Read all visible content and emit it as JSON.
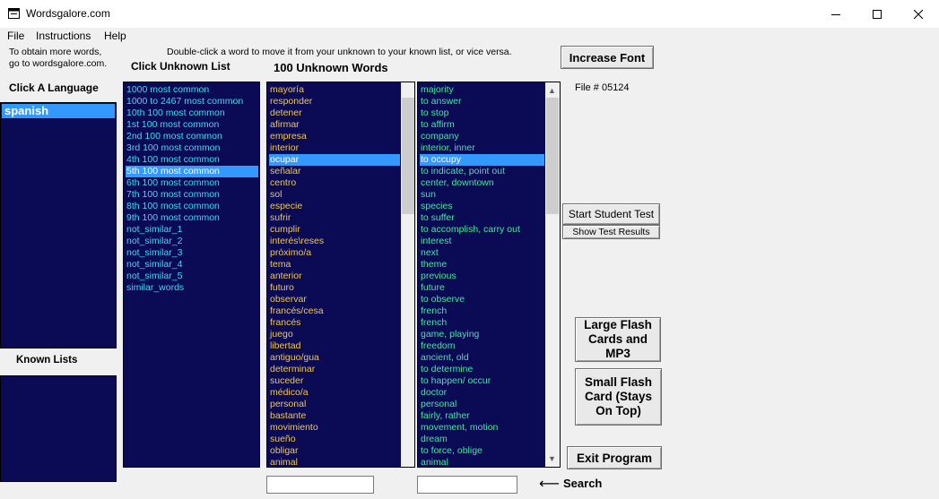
{
  "window": {
    "title": "Wordsgalore.com",
    "minimize_glyph": "—",
    "maximize_glyph": "☐",
    "close_glyph": "✕"
  },
  "menu": [
    "File",
    "Instructions",
    "Help"
  ],
  "info": {
    "line1": "To obtain more words,",
    "line2": "go to wordsgalore.com.",
    "hint": "Double-click a word to move it from your unknown to your known list, or vice versa."
  },
  "labels": {
    "click_unknown_list": "Click Unknown List",
    "unknown_words": "100 Unknown Words",
    "click_a_language": "Click A Language",
    "known_lists": "Known Lists",
    "file_number": "File # 05124",
    "search": "Search",
    "search_arrow": "⟵"
  },
  "languages": {
    "selected": "spanish"
  },
  "unknown_lists": {
    "selected_index": 7,
    "items": [
      "1000 most common",
      "1000 to 2467 most common",
      "10th 100 most common",
      "1st 100 most common",
      "2nd 100 most common",
      "3rd 100 most common",
      "4th 100 most common",
      "5th 100 most common",
      "6th 100 most common",
      "7th 100 most common",
      "8th 100 most common",
      "9th 100 most common",
      "not_similar_1",
      "not_similar_2",
      "not_similar_3",
      "not_similar_4",
      "not_similar_5",
      "similar_words"
    ]
  },
  "spanish_words": {
    "selected_index": 6,
    "items": [
      "mayoría",
      "responder",
      "detener",
      "afirmar",
      "empresa",
      "interior",
      "ocupar",
      "señalar",
      "centro",
      "sol",
      "especie",
      "sufrir",
      "cumplir",
      "interés\\reses",
      "próximo/a",
      "tema",
      "anterior",
      "futuro",
      "observar",
      "francés/cesa",
      "francés",
      "juego",
      "libertad",
      "antiguo/gua",
      "determinar",
      "suceder",
      "médico/a",
      "personal",
      "bastante",
      "movimiento",
      "sueño",
      "obligar",
      "animal"
    ]
  },
  "english_words": {
    "selected_index": 6,
    "items": [
      "majority",
      "to answer",
      "to stop",
      "to affirm",
      "company",
      "interior, inner",
      "to occupy",
      "to indicate, point out",
      "center, downtown",
      "sun",
      "species",
      "to suffer",
      "to accomplish, carry out",
      "interest",
      "next",
      "theme",
      "previous",
      "future",
      "to observe",
      "french",
      "french",
      "game, playing",
      "freedom",
      "ancient, old",
      "to determine",
      "to happen/ occur",
      "doctor",
      "personal",
      "fairly, rather",
      "movement, motion",
      "dream",
      "to force, oblige",
      "animal"
    ]
  },
  "buttons": {
    "increase_font": "Increase Font",
    "start_student_test": "Start Student Test",
    "show_test_results": "Show Test Results",
    "large_flash_1": "Large Flash",
    "large_flash_2": "Cards and",
    "large_flash_3": "MP3",
    "small_flash_1": "Small Flash",
    "small_flash_2": "Card (Stays",
    "small_flash_3": "On Top)",
    "exit_program": "Exit Program"
  },
  "search_inputs": {
    "spanish_value": "",
    "english_value": ""
  },
  "colors": {
    "list_background": "#0a0a55",
    "list_text_cyan": "#33e0f0",
    "list_text_gold": "#f0c850",
    "list_text_green": "#40e8a0",
    "selection": "#3399ff"
  }
}
